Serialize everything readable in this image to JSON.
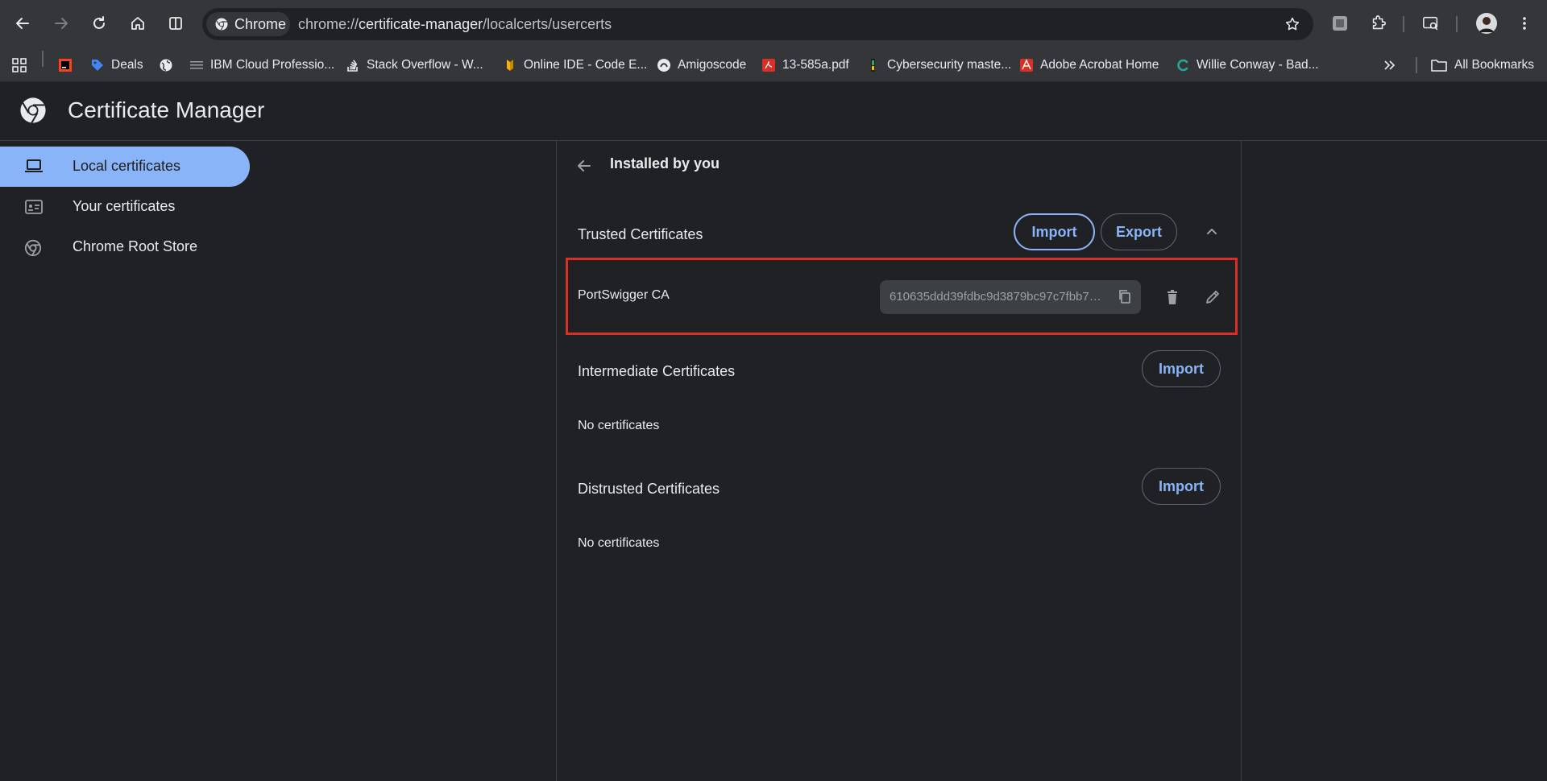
{
  "browser": {
    "chip_label": "Chrome",
    "url_scheme": "chrome://",
    "url_host": "certificate-manager",
    "url_path": "/localcerts/usercerts",
    "bookmarks": [
      {
        "label": "",
        "icon": "jetbrains-icon"
      },
      {
        "label": "Deals",
        "icon": "tag-icon"
      },
      {
        "label": "",
        "icon": "globe-icon"
      },
      {
        "label": "IBM Cloud Professio...",
        "icon": "ibm-icon"
      },
      {
        "label": "Stack Overflow - W...",
        "icon": "stackoverflow-icon"
      },
      {
        "label": "Online IDE - Code E...",
        "icon": "ide-icon"
      },
      {
        "label": "Amigoscode",
        "icon": "amigoscode-icon"
      },
      {
        "label": "13-585a.pdf",
        "icon": "pdf-icon"
      },
      {
        "label": "Cybersecurity maste...",
        "icon": "cyber-icon"
      },
      {
        "label": "Adobe Acrobat Home",
        "icon": "acrobat-icon"
      },
      {
        "label": "Willie Conway - Bad...",
        "icon": "willie-icon"
      }
    ],
    "all_bookmarks_label": "All Bookmarks"
  },
  "app": {
    "title": "Certificate Manager"
  },
  "sidebar": {
    "items": [
      {
        "label": "Local certificates",
        "icon": "laptop-icon",
        "active": true
      },
      {
        "label": "Your certificates",
        "icon": "id-card-icon",
        "active": false
      },
      {
        "label": "Chrome Root Store",
        "icon": "chrome-icon",
        "active": false
      }
    ]
  },
  "main": {
    "subtitle": "Installed by you",
    "trusted": {
      "title": "Trusted Certificates",
      "import_label": "Import",
      "export_label": "Export",
      "certificates": [
        {
          "name": "PortSwigger CA",
          "hash": "610635ddd39fdbc9d3879bc97c7fbb70..."
        }
      ]
    },
    "intermediate": {
      "title": "Intermediate Certificates",
      "import_label": "Import",
      "empty_text": "No certificates"
    },
    "distrusted": {
      "title": "Distrusted Certificates",
      "import_label": "Import",
      "empty_text": "No certificates"
    }
  },
  "colors": {
    "accent": "#8ab4f8",
    "highlight_box": "#d93025",
    "page_bg": "#202124",
    "toolbar_bg": "#35363a"
  }
}
